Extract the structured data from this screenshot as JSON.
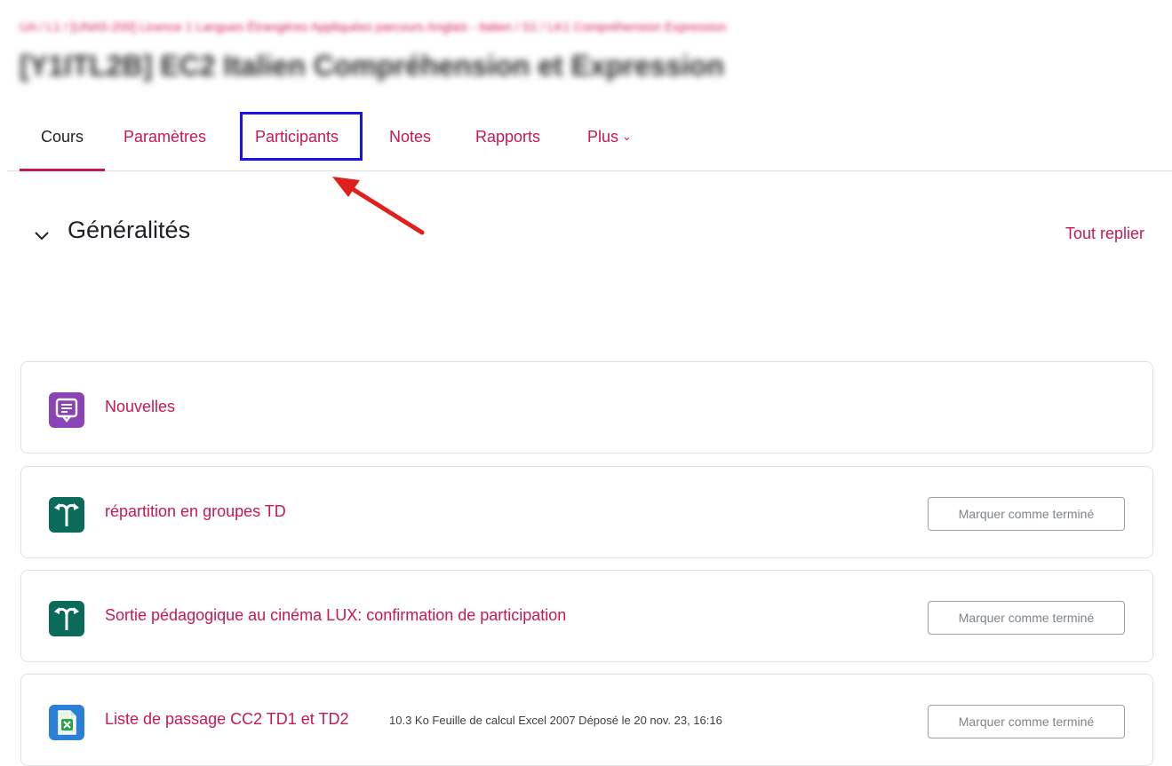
{
  "header": {
    "breadcrumb": "UA / L1 / [UNA5-200] Licence 1 Langues Étrangères Appliquées parcours Anglais - Italien / S1 / LK1 Compréhension Expression",
    "title": "[Y1ITL2B] EC2 Italien Compréhension et Expression"
  },
  "tabs": {
    "cours": "Cours",
    "parametres": "Paramètres",
    "participants": "Participants",
    "notes": "Notes",
    "rapports": "Rapports",
    "plus": "Plus",
    "active": "Cours"
  },
  "section": {
    "title": "Généralités",
    "collapse_all": "Tout replier"
  },
  "activities": [
    {
      "name": "Nouvelles",
      "icon": "forum-icon",
      "icon_color": "#8a44b8"
    },
    {
      "name": "répartition en groupes TD",
      "icon": "choice-icon",
      "icon_color": "#0b6b5b",
      "button": "Marquer comme terminé"
    },
    {
      "name": "Sortie pédagogique au cinéma LUX: confirmation de participation",
      "icon": "choice-icon",
      "icon_color": "#0b6b5b",
      "button": "Marquer comme terminé"
    },
    {
      "name": "Liste de passage CC2 TD1 et TD2",
      "icon": "excel-file-icon",
      "icon_color": "#2c7fd6",
      "meta": "10.3 Ko Feuille de calcul Excel 2007 Déposé le 20 nov. 23, 16:16",
      "button": "Marquer comme terminé"
    }
  ],
  "colors": {
    "accent": "#c8184f",
    "annotation_box": "#1a12e6",
    "annotation_arrow": "#e0201c"
  }
}
